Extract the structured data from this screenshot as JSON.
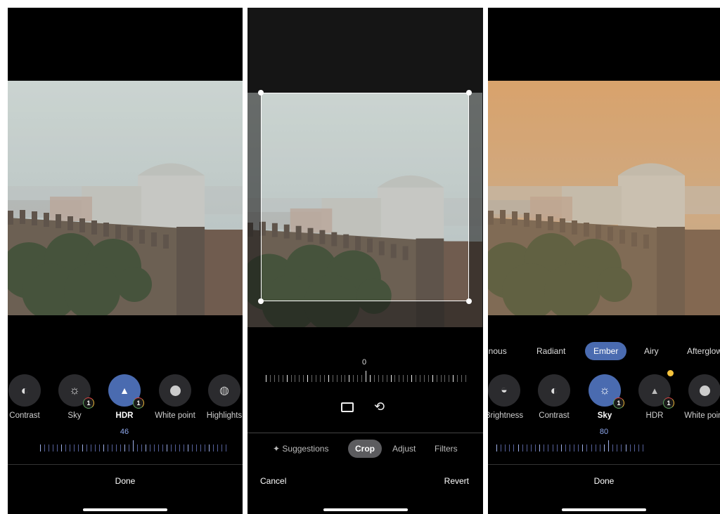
{
  "panels": [
    {
      "tools": [
        {
          "label": "Contrast",
          "icon": "contrast-icon"
        },
        {
          "label": "Sky",
          "icon": "sky-icon",
          "badge": "1"
        },
        {
          "label": "HDR",
          "icon": "hdr-icon",
          "badge": "1",
          "active": true
        },
        {
          "label": "White point",
          "icon": "white-point-icon"
        },
        {
          "label": "Highlights",
          "icon": "highlights-icon"
        }
      ],
      "slider_value": "46",
      "done_label": "Done"
    },
    {
      "rotation_value": "0",
      "tabs": [
        {
          "label": "Suggestions",
          "icon": "sparkle-icon"
        },
        {
          "label": "Crop",
          "active": true
        },
        {
          "label": "Adjust"
        },
        {
          "label": "Filters"
        }
      ],
      "cancel_label": "Cancel",
      "revert_label": "Revert"
    },
    {
      "filters": [
        "inous",
        "Radiant",
        "Ember",
        "Airy",
        "Afterglow"
      ],
      "active_filter": "Ember",
      "tools": [
        {
          "label": "Brightness",
          "icon": "brightness-icon"
        },
        {
          "label": "Contrast",
          "icon": "contrast-icon"
        },
        {
          "label": "Sky",
          "icon": "sky-icon",
          "badge": "1",
          "active": true
        },
        {
          "label": "HDR",
          "icon": "hdr-icon",
          "badge": "1",
          "dot": true
        },
        {
          "label": "White point",
          "icon": "white-point-icon"
        }
      ],
      "slider_value": "80",
      "done_label": "Done"
    }
  ],
  "colors": {
    "accent": "#4a6bb0",
    "badge_dot": "#f6c33c",
    "ember_tint": "#e0a060"
  }
}
